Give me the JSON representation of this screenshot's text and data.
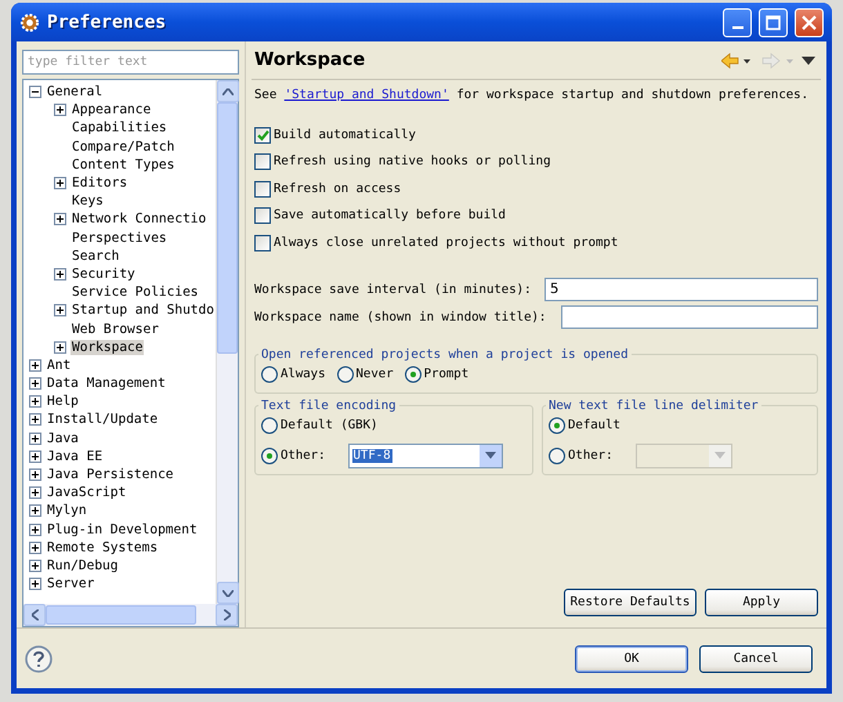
{
  "window": {
    "title": "Preferences"
  },
  "filter": {
    "placeholder": "type filter text"
  },
  "tree": [
    {
      "label": "General",
      "expanded": true,
      "selected": false,
      "children": [
        {
          "label": "Appearance",
          "expanded": false,
          "selected": false
        },
        {
          "label": "Capabilities",
          "selected": false
        },
        {
          "label": "Compare/Patch",
          "selected": false
        },
        {
          "label": "Content Types",
          "selected": false
        },
        {
          "label": "Editors",
          "expanded": false,
          "selected": false
        },
        {
          "label": "Keys",
          "selected": false
        },
        {
          "label": "Network Connectio",
          "expanded": false,
          "selected": false
        },
        {
          "label": "Perspectives",
          "selected": false
        },
        {
          "label": "Search",
          "selected": false
        },
        {
          "label": "Security",
          "expanded": false,
          "selected": false
        },
        {
          "label": "Service Policies",
          "selected": false
        },
        {
          "label": "Startup and Shutdo",
          "expanded": false,
          "selected": false
        },
        {
          "label": "Web Browser",
          "selected": false
        },
        {
          "label": "Workspace",
          "expanded": false,
          "selected": true
        }
      ]
    },
    {
      "label": "Ant",
      "expanded": false,
      "selected": false
    },
    {
      "label": "Data Management",
      "expanded": false,
      "selected": false
    },
    {
      "label": "Help",
      "expanded": false,
      "selected": false
    },
    {
      "label": "Install/Update",
      "expanded": false,
      "selected": false
    },
    {
      "label": "Java",
      "expanded": false,
      "selected": false
    },
    {
      "label": "Java EE",
      "expanded": false,
      "selected": false
    },
    {
      "label": "Java Persistence",
      "expanded": false,
      "selected": false
    },
    {
      "label": "JavaScript",
      "expanded": false,
      "selected": false
    },
    {
      "label": "Mylyn",
      "expanded": false,
      "selected": false
    },
    {
      "label": "Plug-in Development",
      "expanded": false,
      "selected": false
    },
    {
      "label": "Remote Systems",
      "expanded": false,
      "selected": false
    },
    {
      "label": "Run/Debug",
      "expanded": false,
      "selected": false
    },
    {
      "label": "Server",
      "expanded": false,
      "selected": false
    }
  ],
  "page": {
    "title": "Workspace",
    "intro": {
      "before": "See",
      "link": "'Startup and Shutdown'",
      "after": "for workspace startup and shutdown preferences."
    },
    "checkboxes": [
      {
        "label": "Build automatically",
        "checked": true
      },
      {
        "label": "Refresh using native hooks or polling",
        "checked": false
      },
      {
        "label": "Refresh on access",
        "checked": false
      },
      {
        "label": "Save automatically before build",
        "checked": false
      },
      {
        "label": "Always close unrelated projects without prompt",
        "checked": false
      }
    ],
    "fields": [
      {
        "label": "Workspace save interval (in minutes):",
        "value": "5"
      },
      {
        "label": "Workspace name (shown in window title):"
      }
    ],
    "open_referenced": {
      "title": "Open referenced projects when a project is opened",
      "options": [
        {
          "label": "Always",
          "selected": false
        },
        {
          "label": "Never",
          "selected": false
        },
        {
          "label": "Prompt",
          "selected": true
        }
      ]
    },
    "encoding": {
      "title": "Text file encoding",
      "options": [
        {
          "label": "Default (GBK)",
          "selected": false
        },
        {
          "label": "Other:",
          "selected": true,
          "kind": "combo",
          "combo": "UTF-8",
          "disabled": false
        }
      ]
    },
    "delimiter": {
      "title": "New text file line delimiter",
      "options": [
        {
          "label": "Default",
          "selected": true
        },
        {
          "label": "Other:",
          "selected": false,
          "kind": "combo",
          "disabled": true
        }
      ]
    },
    "buttons": [
      "Restore Defaults",
      "Apply"
    ]
  },
  "footer_buttons": [
    "OK",
    "Cancel"
  ]
}
